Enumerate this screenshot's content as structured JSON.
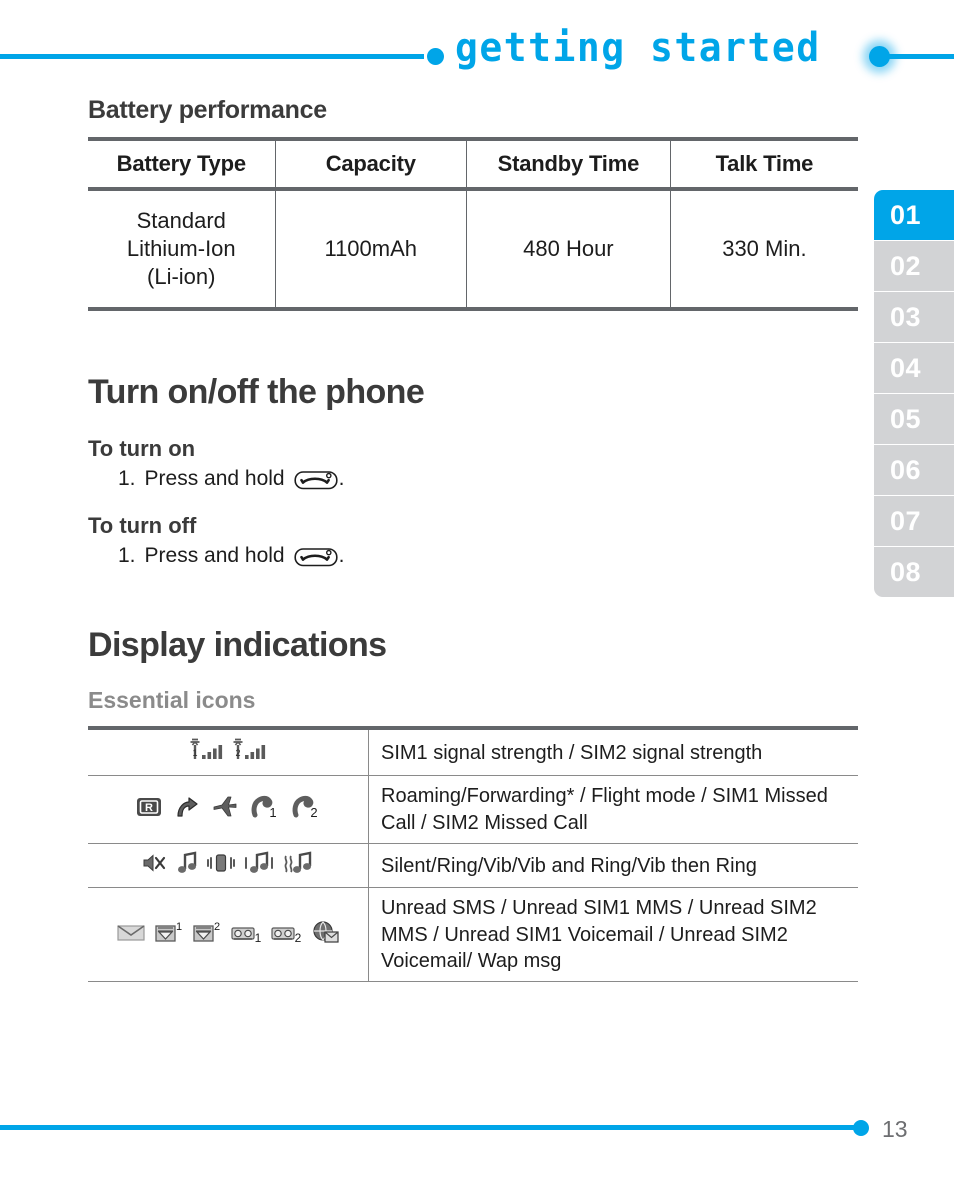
{
  "header": {
    "title": "getting started",
    "accent_color": "#00a5e8"
  },
  "side_tabs": {
    "active_index": 0,
    "items": [
      {
        "label": "01"
      },
      {
        "label": "02"
      },
      {
        "label": "03"
      },
      {
        "label": "04"
      },
      {
        "label": "05"
      },
      {
        "label": "06"
      },
      {
        "label": "07"
      },
      {
        "label": "08"
      }
    ]
  },
  "battery": {
    "heading": "Battery performance",
    "columns": [
      "Battery Type",
      "Capacity",
      "Standby Time",
      "Talk Time"
    ],
    "rows": [
      {
        "type_line1": "Standard",
        "type_line2": "Lithium-Ion",
        "type_line3": "(Li-ion)",
        "capacity": "1100mAh",
        "standby": "480 Hour",
        "talk": "330 Min."
      }
    ]
  },
  "turn_on_off": {
    "heading": "Turn on/off the phone",
    "on": {
      "sub_heading": "To turn on",
      "step_number": "1.",
      "step_text_before": "Press and hold",
      "step_key_icon": "end-call-key-icon",
      "step_text_after": "."
    },
    "off": {
      "sub_heading": "To turn off",
      "step_number": "1.",
      "step_text_before": "Press and hold",
      "step_key_icon": "end-call-key-icon",
      "step_text_after": "."
    }
  },
  "display_indications": {
    "heading": "Display indications",
    "sub_heading": "Essential icons",
    "rows": [
      {
        "icons": [
          "sim1-signal-strength-icon",
          "sim2-signal-strength-icon"
        ],
        "description": "SIM1 signal strength / SIM2 signal strength"
      },
      {
        "icons": [
          "roaming-icon",
          "call-forwarding-icon",
          "flight-mode-icon",
          "sim1-missed-call-icon",
          "sim2-missed-call-icon"
        ],
        "description": "Roaming/Forwarding* / Flight mode / SIM1 Missed Call / SIM2 Missed Call"
      },
      {
        "icons": [
          "silent-icon",
          "ring-icon",
          "vibrate-icon",
          "vibrate-and-ring-icon",
          "vibrate-then-ring-icon"
        ],
        "description": "Silent/Ring/Vib/Vib and Ring/Vib then Ring"
      },
      {
        "icons": [
          "unread-sms-icon",
          "unread-sim1-mms-icon",
          "unread-sim2-mms-icon",
          "unread-sim1-voicemail-icon",
          "unread-sim2-voicemail-icon",
          "wap-msg-icon"
        ],
        "description": "Unread SMS / Unread SIM1 MMS / Unread SIM2 MMS / Unread SIM1 Voicemail / Unread SIM2 Voicemail/ Wap msg"
      }
    ]
  },
  "footer": {
    "page_number": "13"
  }
}
